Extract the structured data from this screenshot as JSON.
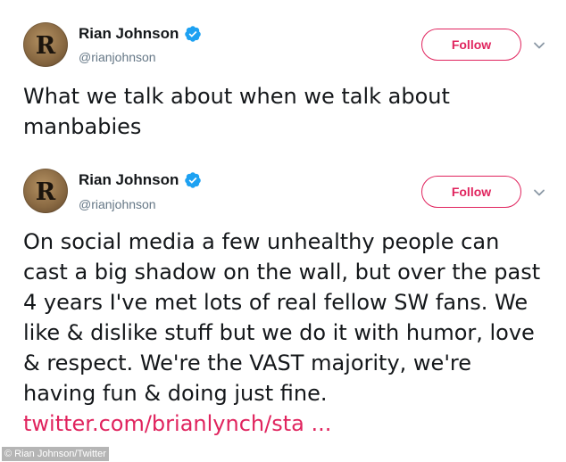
{
  "tweets": [
    {
      "author_name": "Rian Johnson",
      "handle": "@rianjohnson",
      "avatar_letter": "R",
      "verified": true,
      "follow_label": "Follow",
      "text": "What we talk about when we talk about manbabies",
      "link": ""
    },
    {
      "author_name": "Rian Johnson",
      "handle": "@rianjohnson",
      "avatar_letter": "R",
      "verified": true,
      "follow_label": "Follow",
      "text": "On social media a few unhealthy people can cast a big shadow on the wall, but over the past 4 years I've met lots of real fellow SW fans. We like & dislike stuff but we do it with humor, love & respect. We're the VAST majority, we're having fun & doing just fine.",
      "link": "twitter.com/brianlynch/sta ..."
    }
  ],
  "credit": "© Rian Johnson/Twitter",
  "colors": {
    "accent": "#e0245e",
    "verified": "#1da1f2",
    "handle": "#657786",
    "text": "#14171a"
  },
  "icons": {
    "verified": "verified-badge-icon",
    "menu": "chevron-down-icon"
  }
}
